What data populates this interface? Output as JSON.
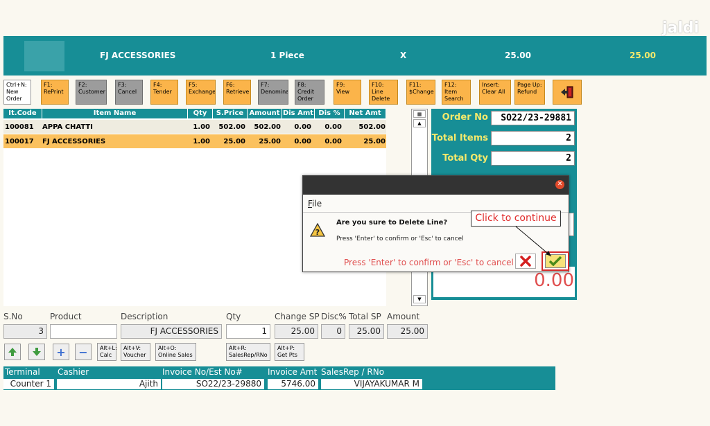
{
  "watermark": "jaldi",
  "topbar": {
    "item_name": "FJ ACCESSORIES",
    "qty": "1 Piece",
    "times": "X",
    "price": "25.00",
    "total": "25.00"
  },
  "fkeys": [
    {
      "label": "Ctrl+N:\nNew\nOrder",
      "style": "white"
    },
    {
      "label": "F1:\nRePrint",
      "style": "orange"
    },
    {
      "label": "F2:\nCustomer",
      "style": "gray"
    },
    {
      "label": "F3:\nCancel",
      "style": "gray"
    },
    {
      "label": "F4:\nTender",
      "style": "orange"
    },
    {
      "label": "F5:\nExchange",
      "style": "orange"
    },
    {
      "label": "F6:\nRetrieve",
      "style": "orange"
    },
    {
      "label": "F7:\nDenomina",
      "style": "gray"
    },
    {
      "label": "F8:\nCredit\nOrder",
      "style": "gray"
    },
    {
      "label": "F9:\nView",
      "style": "orange"
    },
    {
      "label": "F10:\nLine\nDelete",
      "style": "orange"
    },
    {
      "label": "F11:\n$Change",
      "style": "orange"
    },
    {
      "label": "F12:\nItem\nSearch",
      "style": "orange"
    },
    {
      "label": "Insert:\nClear All",
      "style": "orange"
    },
    {
      "label": "Page Up:\nRefund",
      "style": "orange"
    }
  ],
  "grid": {
    "headers": [
      "It.Code",
      "Item Name",
      "Qty",
      "S.Price",
      "Amount",
      "Dis Amt",
      "Dis %",
      "Net Amt"
    ],
    "rows": [
      {
        "code": "100081",
        "name": "APPA CHATTI",
        "qty": "1.00",
        "sprice": "502.00",
        "amount": "502.00",
        "disamt": "0.00",
        "dispct": "0.00",
        "net": "502.00",
        "selected": false
      },
      {
        "code": "100017",
        "name": "FJ ACCESSORIES",
        "qty": "1.00",
        "sprice": "25.00",
        "amount": "25.00",
        "disamt": "0.00",
        "dispct": "0.00",
        "net": "25.00",
        "selected": true
      }
    ]
  },
  "summary": {
    "order_no_label": "Order No",
    "order_no": "SO22/23-29881",
    "total_items_label": "Total Items",
    "total_items": "2",
    "total_qty_label": "Total Qty",
    "total_qty": "2",
    "grand_total": "0.00"
  },
  "entry": {
    "labels": {
      "sno": "S.No",
      "product": "Product",
      "description": "Description",
      "qty": "Qty",
      "change_sp": "Change SP",
      "disc": "Disc%",
      "total_sp": "Total SP",
      "amount": "Amount"
    },
    "values": {
      "sno": "3",
      "product": "",
      "description": "FJ ACCESSORIES",
      "qty": "1",
      "change_sp": "25.00",
      "disc": "0",
      "total_sp": "25.00",
      "amount": "25.00"
    }
  },
  "shortcut_buttons": [
    {
      "label": "Alt+L:\nCalc"
    },
    {
      "label": "Alt+V:\nVoucher"
    },
    {
      "label": "Alt+O:\nOnline Sales"
    },
    {
      "label": "Alt+R:\nSalesRep/RNo"
    },
    {
      "label": "Alt+P:\nGet Pts"
    }
  ],
  "info": {
    "terminal_label": "Terminal",
    "terminal": "Counter 1",
    "cashier_label": "Cashier",
    "cashier": "Ajith",
    "invoice_label": "Invoice No/Est No#",
    "invoice": "SO22/23-29880",
    "amt_label": "Invoice Amt",
    "amt": "5746.00",
    "salesrep_label": "SalesRep / RNo",
    "salesrep": "VIJAYAKUMAR M"
  },
  "dialog": {
    "menu_file": "File",
    "question": "Are you sure to Delete Line?",
    "subtext": "Press 'Enter' to confirm or 'Esc' to cancel",
    "hint": "Press 'Enter' to confirm or 'Esc' to cancel"
  },
  "callout": "Click to continue",
  "colors": {
    "teal": "#178e96",
    "orange": "#fbb44a",
    "selected_row": "#fbc15e",
    "red_text": "#e05050"
  }
}
